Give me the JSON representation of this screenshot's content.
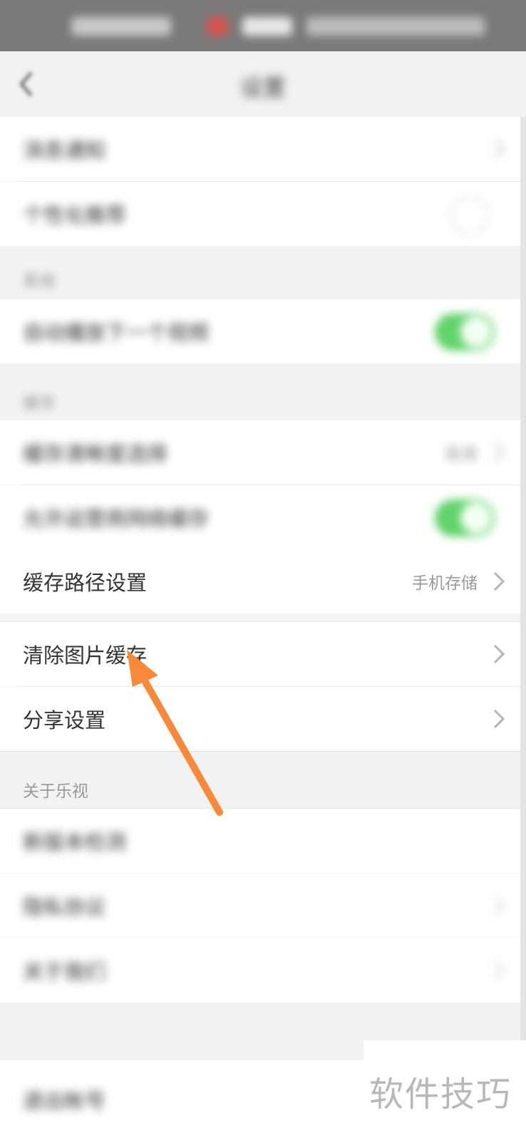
{
  "nav": {
    "title": "设置"
  },
  "settings": {
    "rows_top": [
      {
        "label": "消息通知"
      },
      {
        "label": "个性化推荐"
      }
    ],
    "section_a": "其他",
    "auto_play": {
      "label": "自动播放下一个视频"
    },
    "section_b": "缓存",
    "cache_row1": {
      "label": "缓存清晰度选择",
      "value": "高清"
    },
    "cache_row2": {
      "label": "允许运营商网络缓存"
    },
    "cache_path": {
      "label": "缓存路径设置",
      "value": "手机存储"
    },
    "clear_cache": {
      "label": "清除图片缓存"
    },
    "share": {
      "label": "分享设置"
    },
    "section_about": "关于乐视",
    "about_rows": [
      {
        "label": "新版本检测"
      },
      {
        "label": "隐私协议"
      },
      {
        "label": "关于我们"
      }
    ],
    "logout": {
      "label": "退出帐号"
    }
  },
  "annotation": {
    "arrow_color": "#f78a3a"
  },
  "watermark": {
    "text": "软件技巧"
  },
  "colors": {
    "toggle_on": "#5fd36a",
    "status_bar": "#7a7a7a"
  }
}
